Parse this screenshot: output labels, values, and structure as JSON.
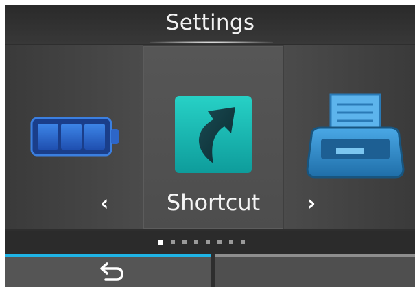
{
  "header": {
    "title": "Settings"
  },
  "carousel": {
    "items": [
      {
        "icon": "battery-icon",
        "label": ""
      },
      {
        "icon": "shortcut-icon",
        "label": "Shortcut"
      },
      {
        "icon": "printer-icon",
        "label": ""
      }
    ],
    "selected_index": 1,
    "prev_arrow": "‹",
    "next_arrow": "›"
  },
  "pager": {
    "total": 8,
    "active_index": 0
  },
  "footer": {
    "back_icon": "return-arrow-icon",
    "left_accent_color": "#1fb4e6",
    "right_accent_color": "#8e8e8e"
  },
  "colors": {
    "background": "#2e2e2e",
    "battery_blue": "#2f6fd0",
    "shortcut_teal": "#17b9b3",
    "printer_blue": "#2e88c6"
  }
}
